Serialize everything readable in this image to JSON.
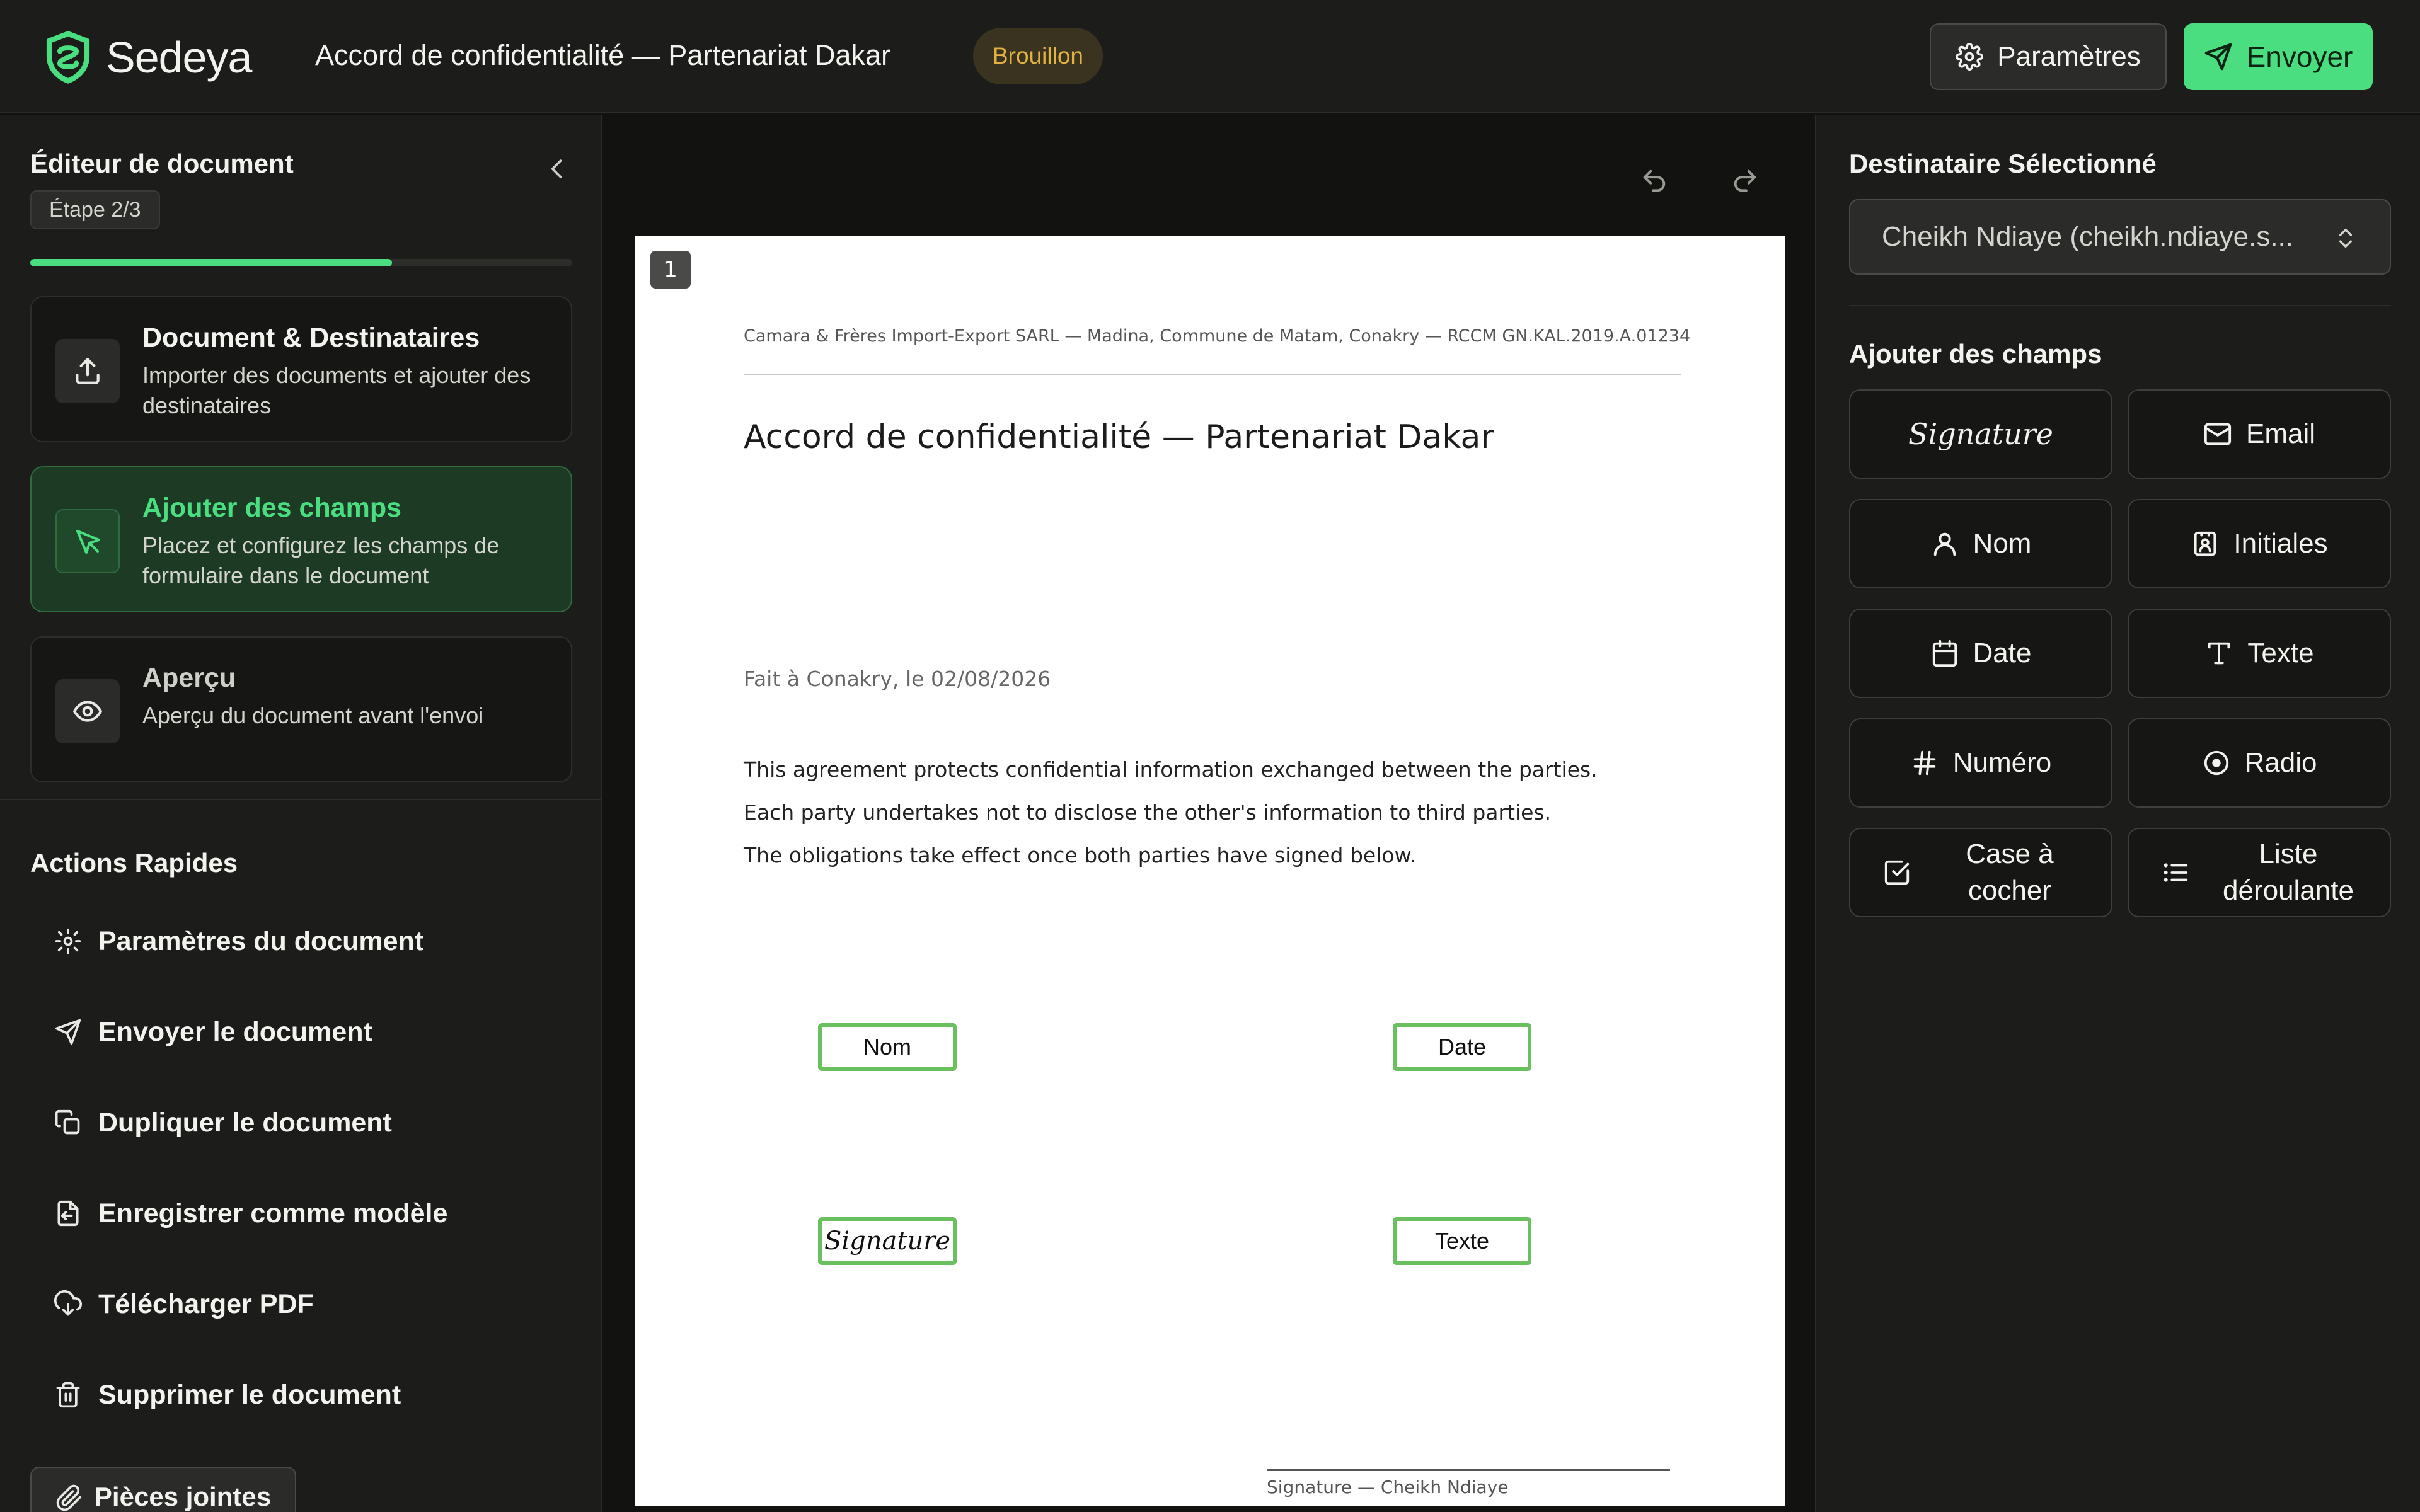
{
  "header": {
    "brand": "Sedeya",
    "document_title": "Accord de confidentialité — Partenariat Dakar",
    "status": "Brouillon",
    "settings_label": "Paramètres",
    "send_label": "Envoyer"
  },
  "sidebar": {
    "title": "Éditeur de document",
    "step": "Étape 2/3",
    "progress": 0.667,
    "steps": [
      {
        "title": "Document & Destinataires",
        "description": "Importer des documents et ajouter des destinataires"
      },
      {
        "title": "Ajouter des champs",
        "description": "Placez et configurez les champs de formulaire dans le document"
      },
      {
        "title": "Aperçu",
        "description": "Aperçu du document avant l'envoi"
      }
    ],
    "quick_actions_title": "Actions Rapides",
    "quick_actions": [
      "Paramètres du document",
      "Envoyer le document",
      "Dupliquer le document",
      "Enregistrer comme modèle",
      "Télécharger PDF",
      "Supprimer le document"
    ],
    "attachments_label": "Pièces jointes"
  },
  "page": {
    "number": "1",
    "letterhead": "Camara & Frères Import-Export SARL — Madina, Commune de Matam, Conakry — RCCM GN.KAL.2019.A.01234",
    "title": "Accord de confidentialité — Partenariat Dakar",
    "paragraphs": [
      "This agreement protects confidential information exchanged between the parties.",
      "Each party undertakes not to disclose the other's information to third parties.",
      "The obligations take effect once both parties have signed below."
    ],
    "place_date": "Fait à Conakry, le 02/08/2026",
    "placed_fields": {
      "name": "Nom",
      "date": "Date",
      "signature": "Signature",
      "text": "Texte"
    },
    "signature_caption": "Signature — Cheikh Ndiaye"
  },
  "right_panel": {
    "recipient_title": "Destinataire Sélectionné",
    "recipient_value": "Cheikh Ndiaye (cheikh.ndiaye.s...",
    "fields_title": "Ajouter des champs",
    "field_types": {
      "signature": "Signature",
      "email": "Email",
      "name": "Nom",
      "initials": "Initiales",
      "date": "Date",
      "text": "Texte",
      "number": "Numéro",
      "radio": "Radio",
      "checkbox": "Case à cocher",
      "dropdown": "Liste déroulante"
    }
  },
  "colors": {
    "accent": "#4ade80",
    "draft_badge": "#e3b341",
    "field_border": "#6abf5e",
    "background": "#121210",
    "panel": "#1c1c1a"
  },
  "icons": {
    "logo": "shield-check-icon",
    "settings": "gear-icon",
    "send": "paper-plane-icon",
    "collapse": "chevron-left-icon",
    "undo": "undo-icon",
    "redo": "redo-icon"
  }
}
